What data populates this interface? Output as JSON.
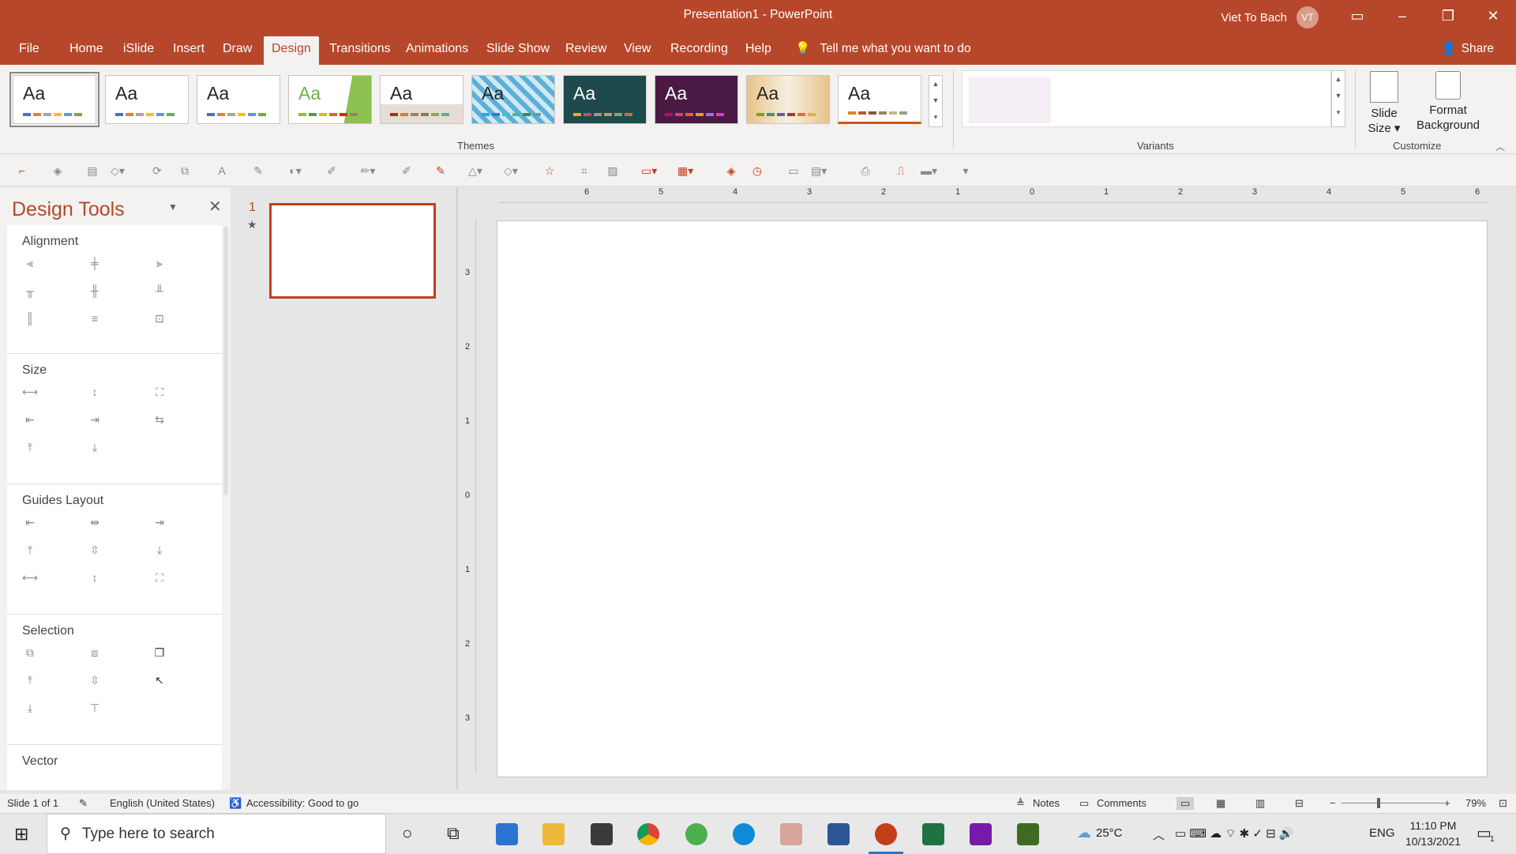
{
  "window": {
    "title": "Presentation1  -  PowerPoint",
    "user_name": "Viet To Bach",
    "user_initials": "VT"
  },
  "tabs": [
    {
      "label": "File"
    },
    {
      "label": "Home"
    },
    {
      "label": "iSlide"
    },
    {
      "label": "Insert"
    },
    {
      "label": "Draw"
    },
    {
      "label": "Design"
    },
    {
      "label": "Transitions"
    },
    {
      "label": "Animations"
    },
    {
      "label": "Slide Show"
    },
    {
      "label": "Review"
    },
    {
      "label": "View"
    },
    {
      "label": "Recording"
    },
    {
      "label": "Help"
    }
  ],
  "active_tab": "Design",
  "tell_me": "Tell me what you want to do",
  "share_label": "Share",
  "ribbon": {
    "themes_label": "Themes",
    "variants_label": "Variants",
    "customize_label": "Customize",
    "theme_sample_text": "Aa",
    "slide_size_label": "Slide Size",
    "format_background_label": "Format Background"
  },
  "design_tools": {
    "title": "Design Tools",
    "sections": [
      {
        "title": "Alignment"
      },
      {
        "title": "Size"
      },
      {
        "title": "Guides Layout"
      },
      {
        "title": "Selection"
      },
      {
        "title": "Vector"
      }
    ]
  },
  "slides": {
    "number": "1",
    "star": "★"
  },
  "ruler": {
    "horizontal": [
      "6",
      "5",
      "4",
      "3",
      "2",
      "1",
      "0",
      "1",
      "2",
      "3",
      "4",
      "5",
      "6"
    ],
    "vertical": [
      "3",
      "2",
      "1",
      "0",
      "1",
      "2",
      "3"
    ]
  },
  "status": {
    "slide_info": "Slide 1 of 1",
    "language": "English (United States)",
    "accessibility": "Accessibility: Good to go",
    "notes": "Notes",
    "comments": "Comments",
    "zoom": "79%"
  },
  "taskbar": {
    "search_placeholder": "Type here to search",
    "temperature": "25°C",
    "language": "ENG",
    "time": "11:10 PM",
    "date": "10/13/2021",
    "notification_count": "1"
  },
  "colors": {
    "accent": "#b7472a",
    "selection": "#c43e1c"
  }
}
